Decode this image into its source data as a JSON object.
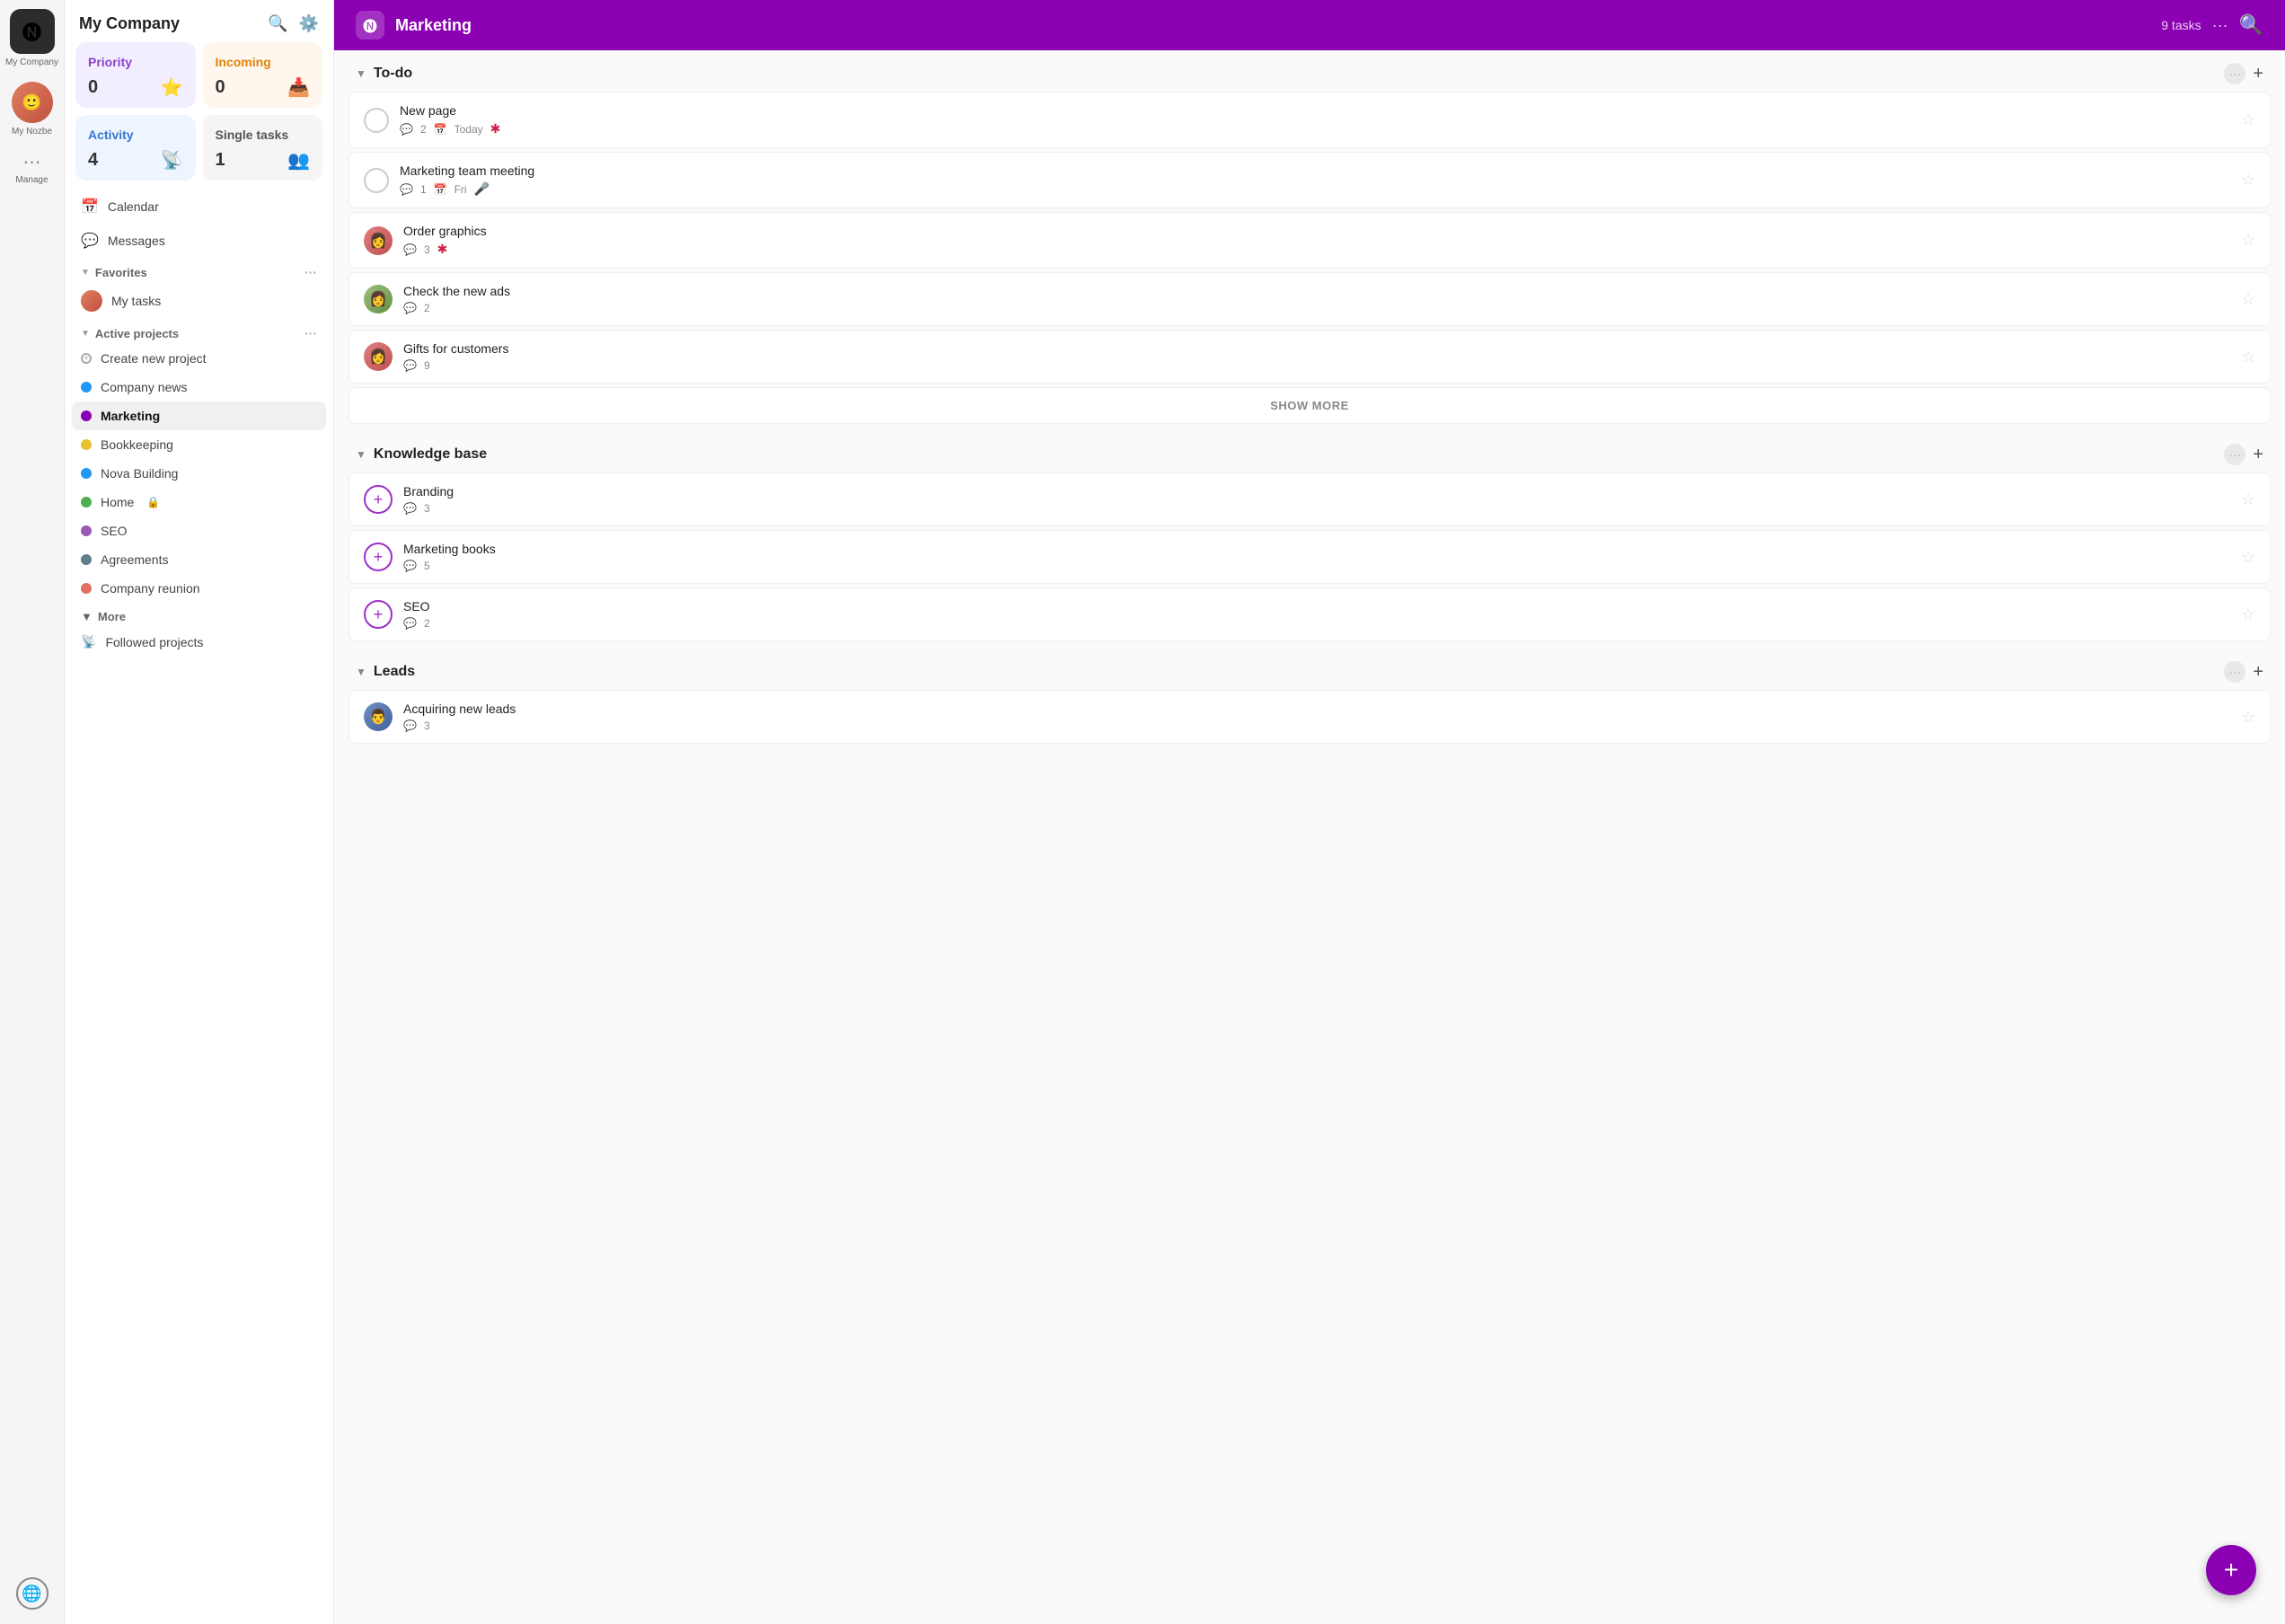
{
  "iconRail": {
    "companyName": "My Company",
    "myNozbeLabel": "My Nozbe",
    "manageLabel": "Manage"
  },
  "sidebar": {
    "title": "My Company",
    "quickStats": {
      "priority": {
        "label": "Priority",
        "count": "0",
        "icon": "⭐"
      },
      "incoming": {
        "label": "Incoming",
        "count": "0",
        "icon": "📥"
      },
      "activity": {
        "label": "Activity",
        "count": "4",
        "icon": "📡"
      },
      "single": {
        "label": "Single tasks",
        "count": "1",
        "icon": "👥"
      }
    },
    "navItems": [
      {
        "label": "Calendar",
        "icon": "📅"
      },
      {
        "label": "Messages",
        "icon": "💬"
      }
    ],
    "favorites": {
      "label": "Favorites",
      "items": [
        {
          "label": "My tasks",
          "dot": "#e08060"
        }
      ]
    },
    "activeProjects": {
      "label": "Active projects",
      "items": [
        {
          "label": "Create new project",
          "type": "add"
        },
        {
          "label": "Company news",
          "color": "#2196F3",
          "type": "dot"
        },
        {
          "label": "Marketing",
          "color": "#8b00b3",
          "type": "dot",
          "active": true
        },
        {
          "label": "Bookkeeping",
          "color": "#e8c030",
          "type": "dot"
        },
        {
          "label": "Nova Building",
          "color": "#2196F3",
          "type": "dot"
        },
        {
          "label": "Home",
          "color": "#4caf50",
          "type": "dot",
          "lock": true
        },
        {
          "label": "SEO",
          "color": "#9b59b6",
          "type": "dot"
        },
        {
          "label": "Agreements",
          "color": "#607d8b",
          "type": "dot"
        },
        {
          "label": "Company reunion",
          "color": "#e07060",
          "type": "dot"
        }
      ]
    },
    "more": {
      "label": "More",
      "items": [
        {
          "label": "Followed projects",
          "icon": "📡"
        }
      ]
    }
  },
  "main": {
    "header": {
      "title": "Marketing",
      "taskCount": "9 tasks"
    },
    "sections": [
      {
        "id": "todo",
        "title": "To-do",
        "tasks": [
          {
            "id": "t1",
            "title": "New page",
            "comments": "2",
            "date": "Today",
            "priority": true,
            "avatarType": "circle"
          },
          {
            "id": "t2",
            "title": "Marketing team meeting",
            "comments": "1",
            "date": "Fri",
            "priority": false,
            "avatarType": "circle",
            "mic": true
          },
          {
            "id": "t3",
            "title": "Order graphics",
            "comments": "3",
            "priority": true,
            "avatarType": "female1"
          },
          {
            "id": "t4",
            "title": "Check the new ads",
            "comments": "2",
            "priority": false,
            "avatarType": "female2"
          },
          {
            "id": "t5",
            "title": "Gifts for customers",
            "comments": "9",
            "priority": false,
            "avatarType": "female1"
          }
        ],
        "showMore": "SHOW MORE"
      },
      {
        "id": "knowledge",
        "title": "Knowledge base",
        "tasks": [
          {
            "id": "k1",
            "title": "Branding",
            "comments": "3",
            "avatarType": "add"
          },
          {
            "id": "k2",
            "title": "Marketing books",
            "comments": "5",
            "avatarType": "add"
          },
          {
            "id": "k3",
            "title": "SEO",
            "comments": "2",
            "avatarType": "add"
          }
        ]
      },
      {
        "id": "leads",
        "title": "Leads",
        "tasks": [
          {
            "id": "l1",
            "title": "Acquiring new leads",
            "comments": "3",
            "avatarType": "male1"
          }
        ]
      }
    ]
  }
}
